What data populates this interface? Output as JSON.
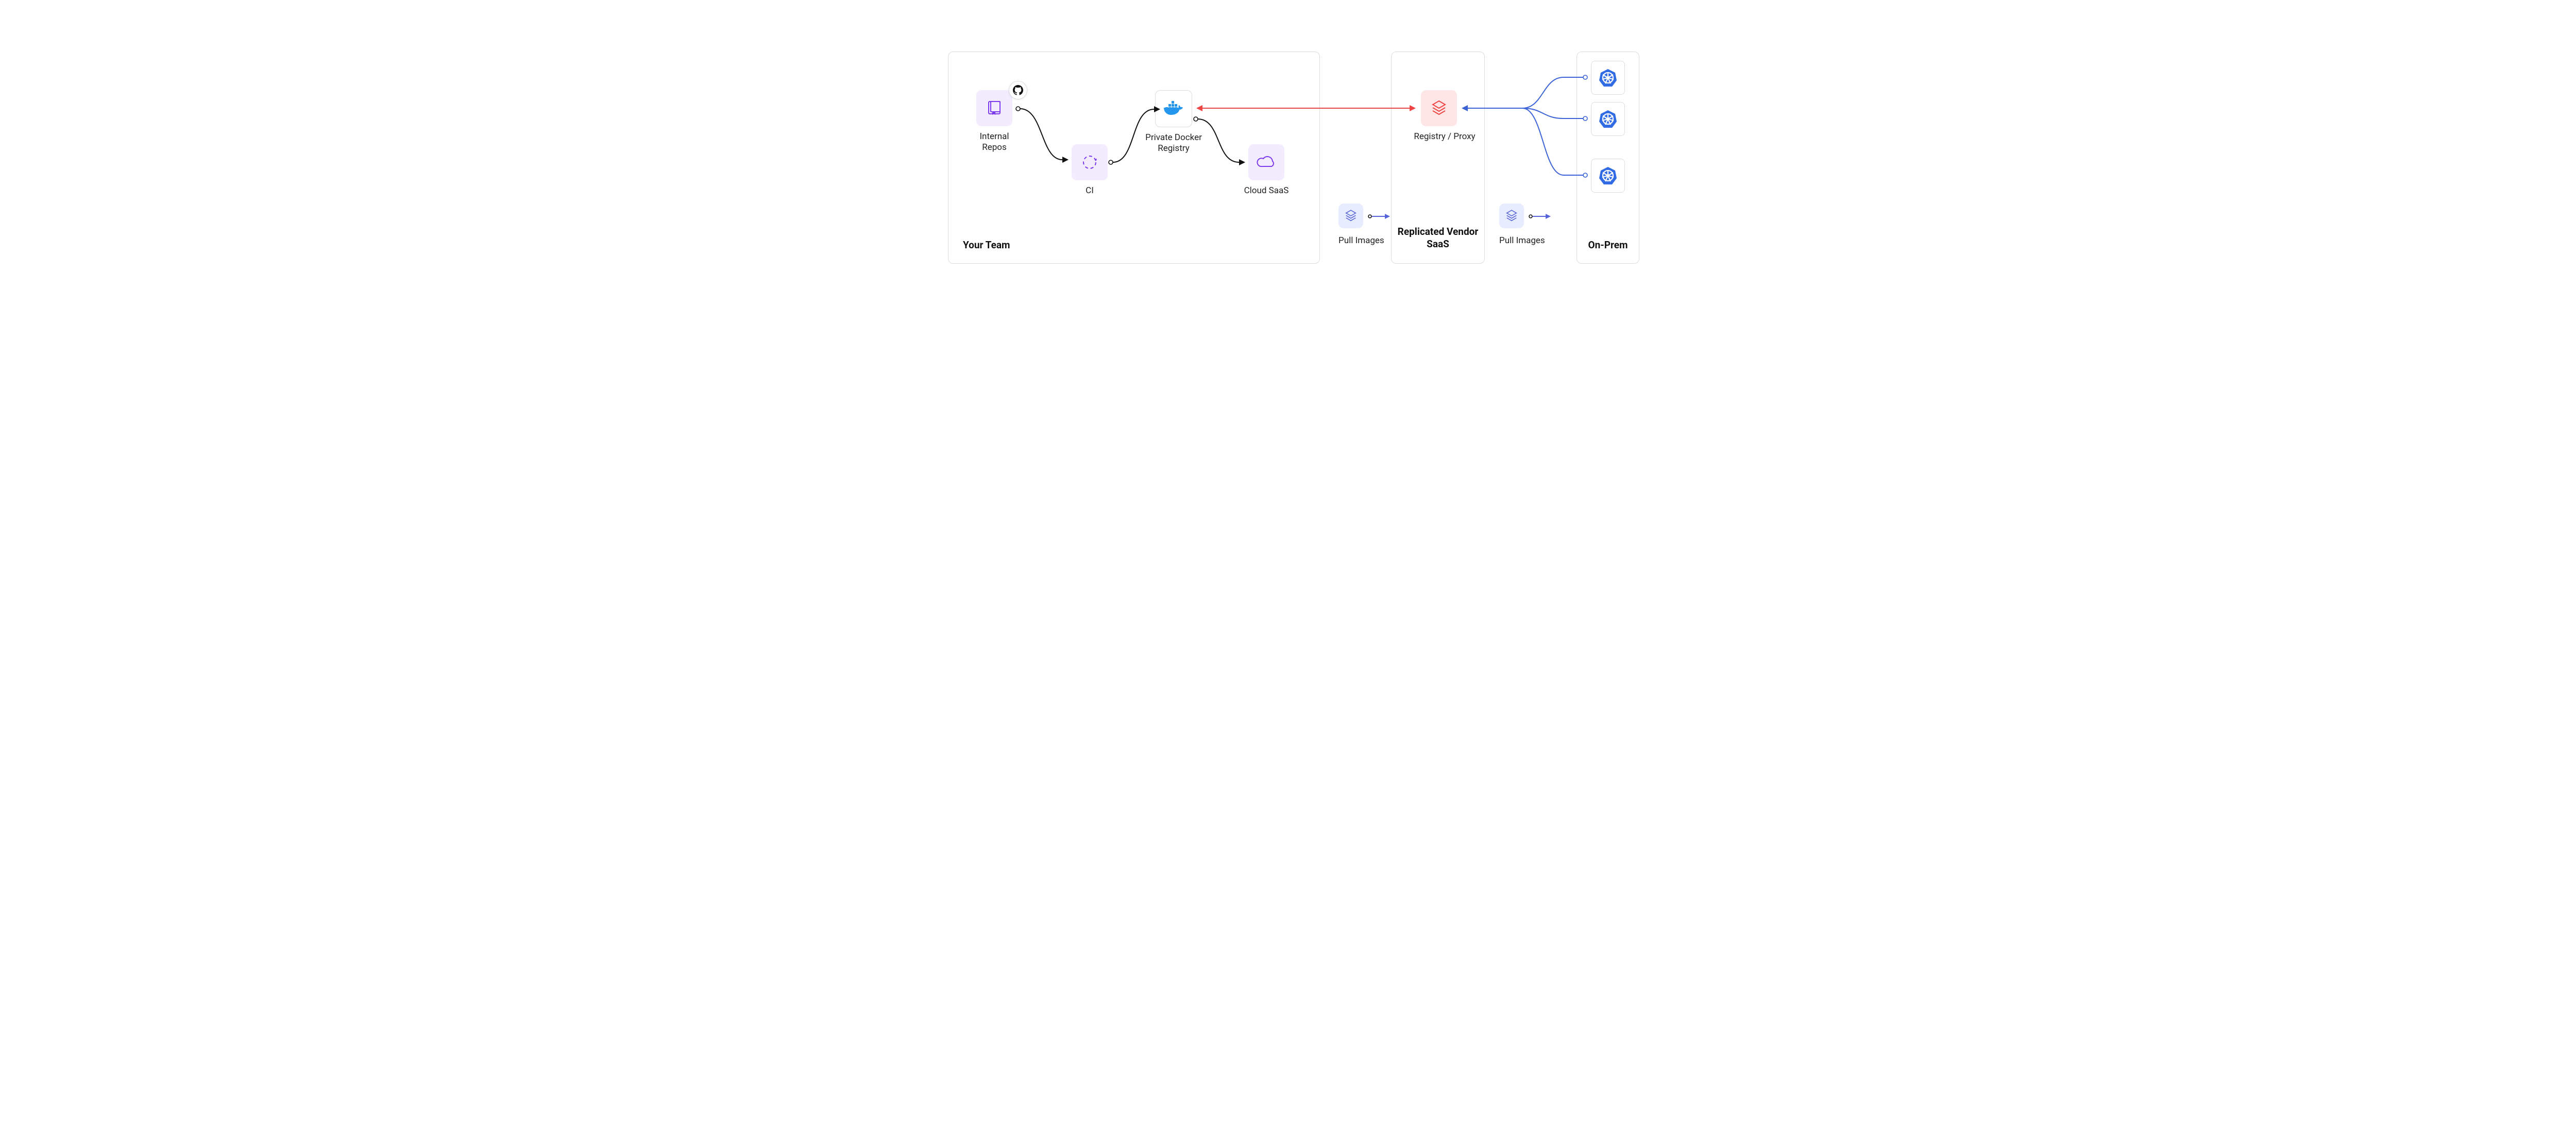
{
  "panels": {
    "team": {
      "title": "Your Team"
    },
    "vendor": {
      "title": "Replicated Vendor SaaS"
    },
    "onprem": {
      "title": "On-Prem"
    }
  },
  "nodes": {
    "repos": {
      "label": "Internal Repos"
    },
    "ci": {
      "label": "CI"
    },
    "registry": {
      "label": "Private Docker Registry"
    },
    "saas": {
      "label": "Cloud SaaS"
    },
    "proxy": {
      "label": "Registry / Proxy"
    },
    "pull1": {
      "label": "Pull Images"
    },
    "pull2": {
      "label": "Pull Images"
    }
  },
  "colors": {
    "purple": "#7c3aed",
    "blue": "#3b63d6",
    "red": "#ef4444",
    "k8s": "#326ce5",
    "pull": "#5765d8"
  }
}
